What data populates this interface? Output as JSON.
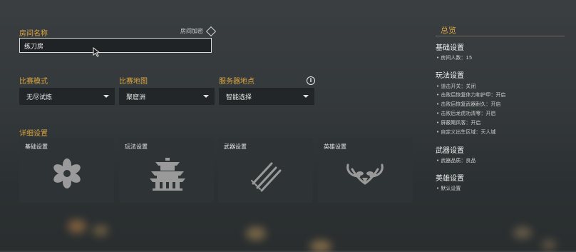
{
  "room": {
    "name_label": "房间名称",
    "name_value": "练刀房",
    "encrypt_label": "房间加密"
  },
  "match": {
    "mode_label": "比赛模式",
    "mode_value": "无尽试炼",
    "map_label": "比赛地图",
    "map_value": "聚窟洲",
    "server_label": "服务器地点",
    "server_value": "智能选择"
  },
  "details": {
    "label": "详细设置",
    "cards": [
      "基础设置",
      "玩法设置",
      "武器设置",
      "英雄设置"
    ]
  },
  "summary": {
    "title": "总览",
    "sections": [
      {
        "heading": "基础设置",
        "items": [
          "房间人数：15"
        ]
      },
      {
        "heading": "玩法设置",
        "items": [
          "道击开关：关闭",
          "击败后恢复体力和护甲：开启",
          "击败后恢复武器耐久：开启",
          "击败后龙虎功清零：开启",
          "屏蔽飓风客：开启",
          "自定义出生区域：天人城"
        ]
      },
      {
        "heading": "武器设置",
        "items": [
          "武器品质：良品"
        ]
      },
      {
        "heading": "英雄设置",
        "items": [
          "默认设置"
        ]
      }
    ]
  },
  "colors": {
    "accent": "#d9a441",
    "panel": "#2e3335",
    "dropdown": "#232628"
  },
  "icons": [
    "diamond-icon",
    "info-icon",
    "flower-icon",
    "pavilion-icon",
    "swords-icon",
    "mask-icon",
    "mouse-cursor-icon"
  ]
}
